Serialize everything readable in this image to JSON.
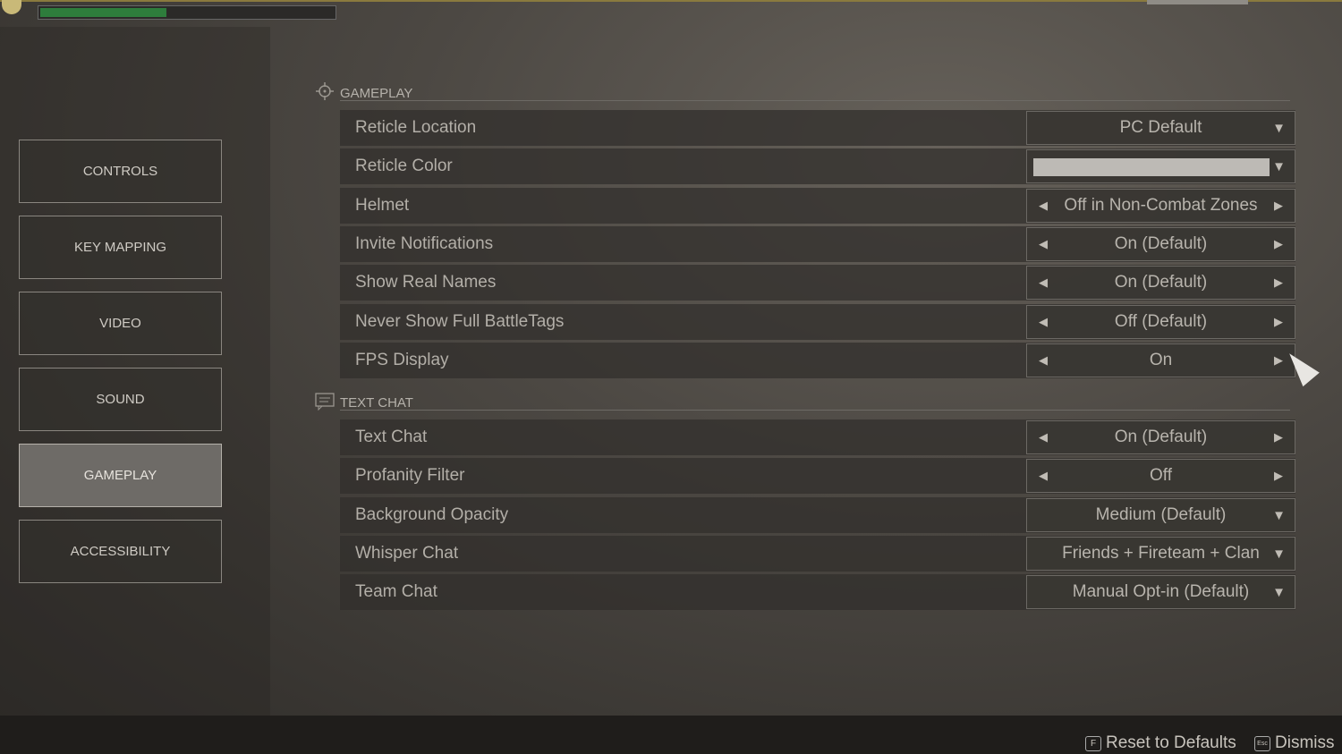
{
  "status": {
    "progress_percent": 43,
    "progress_color": "#2e7d3c"
  },
  "sidebar": {
    "items": [
      {
        "label": "CONTROLS",
        "active": false
      },
      {
        "label": "KEY MAPPING",
        "active": false
      },
      {
        "label": "VIDEO",
        "active": false
      },
      {
        "label": "SOUND",
        "active": false
      },
      {
        "label": "GAMEPLAY",
        "active": true
      },
      {
        "label": "ACCESSIBILITY",
        "active": false
      }
    ]
  },
  "gameplay": {
    "title": "GAMEPLAY",
    "icon": "crosshair-icon",
    "rows": [
      {
        "label": "Reticle Location",
        "value": "PC Default",
        "type": "dropdown"
      },
      {
        "label": "Reticle Color",
        "value": "",
        "type": "color",
        "swatch": "#bdbab5"
      },
      {
        "label": "Helmet",
        "value": "Off in Non-Combat Zones",
        "type": "toggle"
      },
      {
        "label": "Invite Notifications",
        "value": "On (Default)",
        "type": "toggle"
      },
      {
        "label": "Show Real Names",
        "value": "On (Default)",
        "type": "toggle"
      },
      {
        "label": "Never Show Full BattleTags",
        "value": "Off (Default)",
        "type": "toggle"
      },
      {
        "label": "FPS Display",
        "value": "On",
        "type": "toggle"
      }
    ]
  },
  "textchat": {
    "title": "TEXT CHAT",
    "icon": "chat-icon",
    "rows": [
      {
        "label": "Text Chat",
        "value": "On (Default)",
        "type": "toggle"
      },
      {
        "label": "Profanity Filter",
        "value": "Off",
        "type": "toggle"
      },
      {
        "label": "Background Opacity",
        "value": "Medium (Default)",
        "type": "dropdown"
      },
      {
        "label": "Whisper Chat",
        "value": "Friends + Fireteam + Clan",
        "type": "dropdown"
      },
      {
        "label": "Team Chat",
        "value": "Manual Opt-in (Default)",
        "type": "dropdown"
      }
    ]
  },
  "footer": {
    "reset_key": "F",
    "reset_label": "Reset to Defaults",
    "dismiss_key": "Esc",
    "dismiss_label": "Dismiss"
  }
}
